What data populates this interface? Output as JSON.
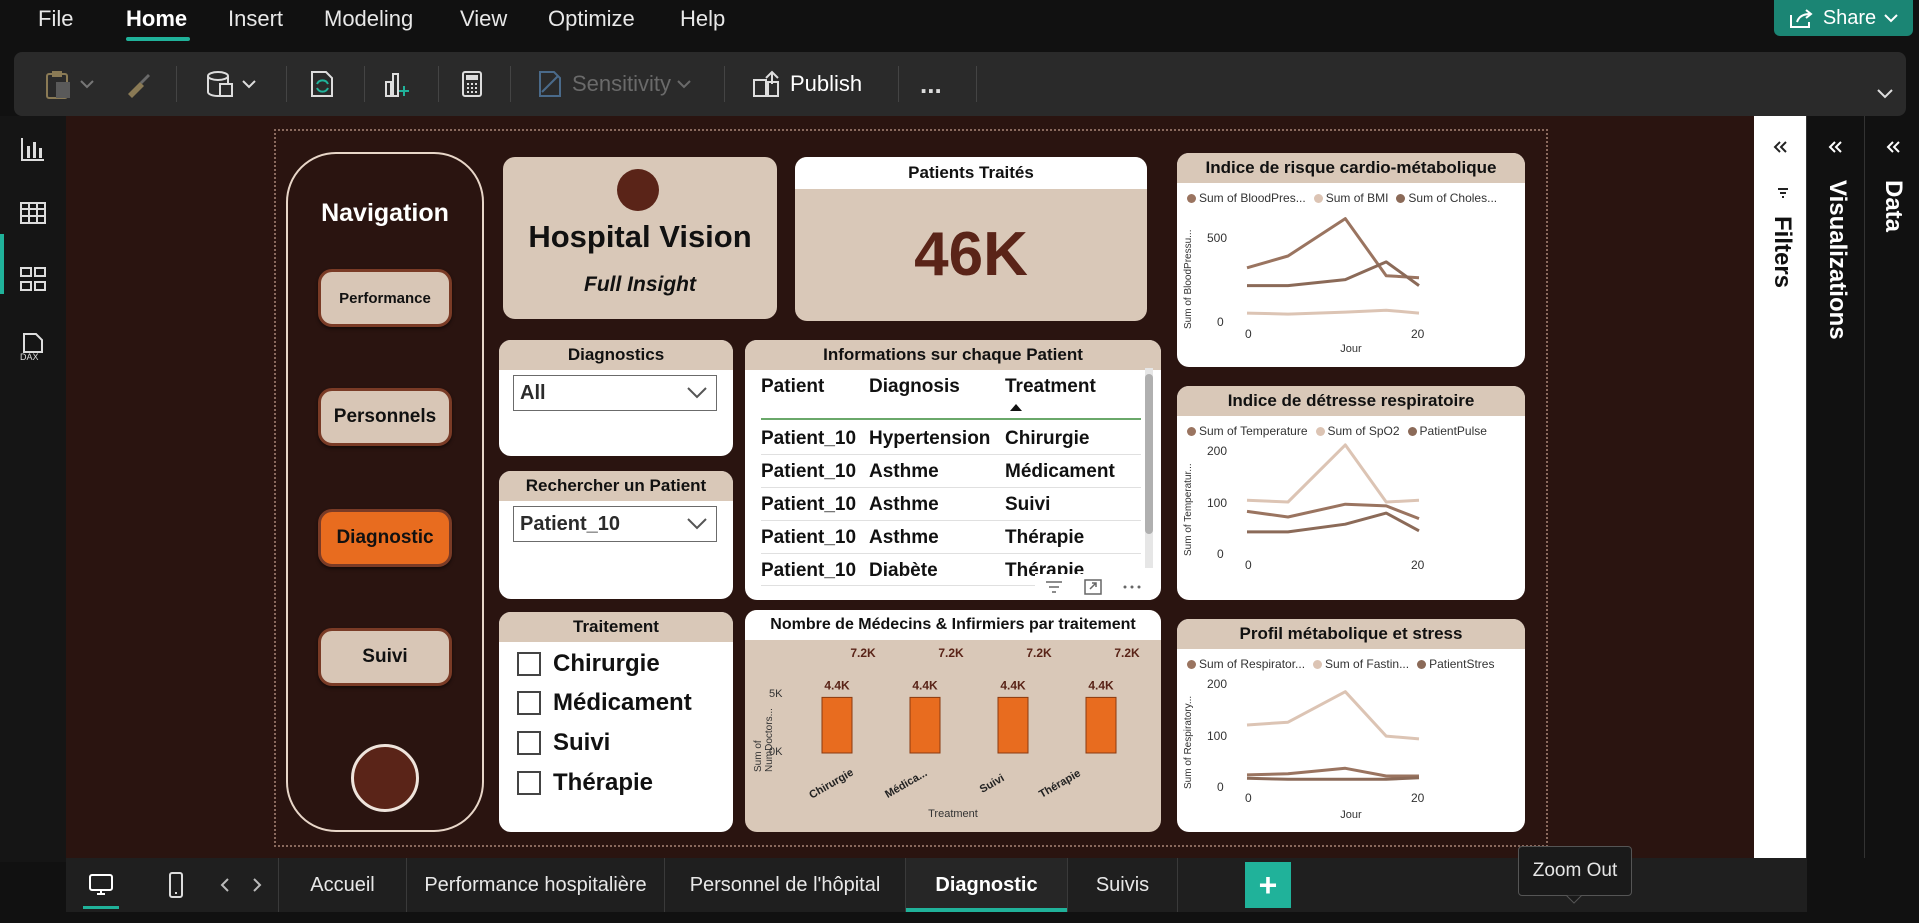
{
  "menu": {
    "items": [
      "File",
      "Home",
      "Insert",
      "Modeling",
      "View",
      "Optimize",
      "Help"
    ],
    "active": "Home",
    "share_label": "Share"
  },
  "ribbon": {
    "sensitivity_label": "Sensitivity",
    "publish_label": "Publish",
    "more_label": "..."
  },
  "nav": {
    "title": "Navigation",
    "buttons": [
      "Performance",
      "Personnels",
      "Diagnostic",
      "Suivi"
    ],
    "active": "Diagnostic"
  },
  "brand": {
    "title": "Hospital Vision",
    "subtitle": "Full Insight"
  },
  "kpi": {
    "title": "Patients Traités",
    "value": "46K"
  },
  "diagnostics_slicer": {
    "title": "Diagnostics",
    "value": "All"
  },
  "patient_search": {
    "title": "Rechercher un Patient",
    "value": "Patient_10"
  },
  "treatment_slicer": {
    "title": "Traitement",
    "options": [
      "Chirurgie",
      "Médicament",
      "Suivi",
      "Thérapie"
    ]
  },
  "patient_table": {
    "title": "Informations sur chaque Patient",
    "columns": [
      "Patient",
      "Diagnosis",
      "Treatment"
    ],
    "rows": [
      [
        "Patient_10",
        "Hypertension",
        "Chirurgie"
      ],
      [
        "Patient_10",
        "Asthme",
        "Médicament"
      ],
      [
        "Patient_10",
        "Asthme",
        "Suivi"
      ],
      [
        "Patient_10",
        "Asthme",
        "Thérapie"
      ],
      [
        "Patient_10",
        "Diabète",
        "Thérapie"
      ]
    ]
  },
  "staff_chart": {
    "title": "Nombre de Médecins & Infirmiers par traitement",
    "ylabel": "Sum of NumDoctors...",
    "xlabel": "Treatment",
    "yticks": [
      "5K",
      "0K"
    ],
    "tick_labels": [
      "Chirurgie",
      "Médica...",
      "Suivi",
      "Thérapie"
    ]
  },
  "line_charts": {
    "cardio": {
      "title": "Indice de risque cardio-métabolique",
      "legend": [
        "Sum of BloodPres...",
        "Sum of BMI",
        "Sum of Choles..."
      ],
      "ylabel": "Sum of BloodPressu...",
      "xlabel": "Jour",
      "yticks": [
        "500",
        "0"
      ],
      "xticks": [
        "0",
        "20"
      ]
    },
    "resp": {
      "title": "Indice de détresse respiratoire",
      "legend": [
        "Sum of Temperature",
        "Sum of SpO2",
        "PatientPulse"
      ],
      "ylabel": "Sum of Temperatur...",
      "xlabel": "",
      "yticks": [
        "200",
        "100",
        "0"
      ],
      "xticks": [
        "0",
        "20"
      ]
    },
    "meta": {
      "title": "Profil métabolique et stress",
      "legend": [
        "Sum of Respirator...",
        "Sum of Fastin...",
        "PatientStres"
      ],
      "ylabel": "Sum of Respiratory...",
      "xlabel": "Jour",
      "yticks": [
        "200",
        "100",
        "0"
      ],
      "xticks": [
        "0",
        "20"
      ]
    }
  },
  "panes": {
    "filters": "Filters",
    "visualizations": "Visualizations",
    "data": "Data"
  },
  "pages": {
    "tabs": [
      "Accueil",
      "Performance hospitalière",
      "Personnel de l'hôpital",
      "Diagnostic",
      "Suivis"
    ],
    "active": "Diagnostic",
    "add_label": "+"
  },
  "tooltip": "Zoom Out",
  "colors": {
    "accent": "#20b29a",
    "canvas": "#2a1410",
    "card": "#d9c8b8",
    "bar": "#e86c1f",
    "series_dark": "#9a7460",
    "series_light": "#dcc4b4",
    "series_mid": "#8b6a58"
  },
  "chart_data": [
    {
      "type": "bar",
      "title": "Nombre de Médecins & Infirmiers par traitement",
      "categories": [
        "Chirurgie",
        "Médica...",
        "Suivi",
        "Thérapie"
      ],
      "series": [
        {
          "values": [
            4400,
            4400,
            4400,
            4400
          ]
        }
      ],
      "data_labels": [
        "4.4K",
        "4.4K",
        "4.4K",
        "4.4K"
      ],
      "total_labels": [
        "7.2K",
        "7.2K",
        "7.2K",
        "7.2K"
      ],
      "xlabel": "Treatment",
      "ylabel": "Sum of NumDoctors...",
      "ylim": [
        0,
        7200
      ]
    },
    {
      "type": "line",
      "title": "Indice de risque cardio-métabolique",
      "x": [
        0,
        5,
        12,
        17,
        21
      ],
      "series": [
        {
          "name": "Sum of BloodPres...",
          "values": [
            270,
            330,
            520,
            230,
            220
          ]
        },
        {
          "name": "Sum of BMI",
          "values": [
            40,
            35,
            45,
            55,
            40
          ]
        },
        {
          "name": "Sum of Choles...",
          "values": [
            180,
            180,
            210,
            300,
            180
          ]
        }
      ],
      "xlabel": "Jour",
      "ylabel": "Sum of BloodPressu...",
      "ylim": [
        0,
        650
      ]
    },
    {
      "type": "line",
      "title": "Indice de détresse respiratoire",
      "x": [
        0,
        5,
        12,
        17,
        21
      ],
      "series": [
        {
          "name": "Sum of Temperature",
          "values": [
            75,
            65,
            88,
            85,
            62
          ]
        },
        {
          "name": "Sum of SpO2",
          "values": [
            95,
            92,
            195,
            92,
            95
          ]
        },
        {
          "name": "PatientPulse",
          "values": [
            38,
            38,
            52,
            72,
            40
          ]
        }
      ],
      "xlabel": "",
      "ylabel": "Sum of Temperatur...",
      "ylim": [
        0,
        220
      ]
    },
    {
      "type": "line",
      "title": "Profil métabolique et stress",
      "x": [
        0,
        5,
        12,
        17,
        21
      ],
      "series": [
        {
          "name": "Sum of Respirator...",
          "values": [
            20,
            22,
            32,
            18,
            18
          ]
        },
        {
          "name": "Sum of Fastin...",
          "values": [
            110,
            115,
            170,
            90,
            85
          ]
        },
        {
          "name": "PatientStres",
          "values": [
            14,
            12,
            12,
            12,
            15
          ]
        }
      ],
      "xlabel": "Jour",
      "ylabel": "Sum of Respiratory...",
      "ylim": [
        0,
        220
      ]
    }
  ]
}
